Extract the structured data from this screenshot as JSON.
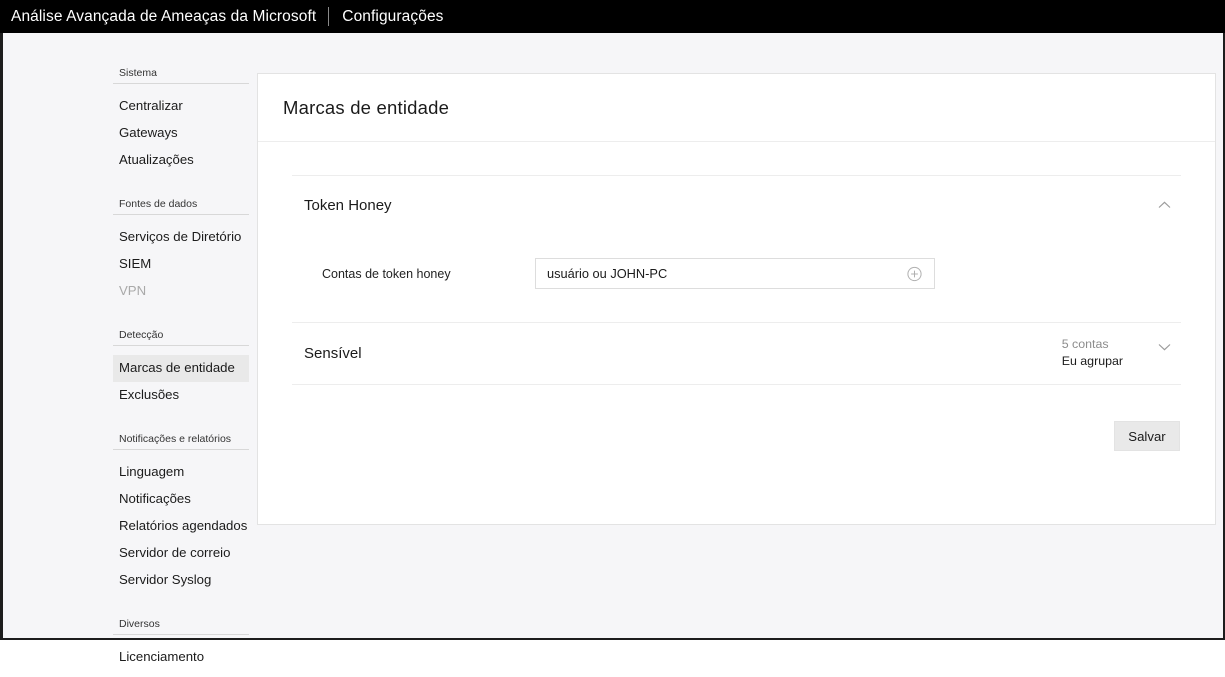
{
  "topbar": {
    "product": "Análise Avançada de Ameaças da Microsoft",
    "section": "Configurações"
  },
  "sidebar": {
    "groups": [
      {
        "title": "Sistema",
        "items": [
          {
            "label": "Centralizar",
            "state": "normal"
          },
          {
            "label": "Gateways",
            "state": "normal"
          },
          {
            "label": "Atualizações",
            "state": "normal"
          }
        ]
      },
      {
        "title": "Fontes de dados",
        "items": [
          {
            "label": "Serviços de Diretório",
            "state": "normal"
          },
          {
            "label": "SIEM",
            "state": "normal"
          },
          {
            "label": "VPN",
            "state": "disabled"
          }
        ]
      },
      {
        "title": "Detecção",
        "items": [
          {
            "label": "Marcas de entidade",
            "state": "selected"
          },
          {
            "label": "Exclusões",
            "state": "normal"
          }
        ]
      },
      {
        "title": "Notificações e relatórios",
        "items": [
          {
            "label": "Linguagem",
            "state": "normal"
          },
          {
            "label": "Notificações",
            "state": "normal"
          },
          {
            "label": "Relatórios agendados",
            "state": "normal"
          },
          {
            "label": "Servidor de correio",
            "state": "normal"
          },
          {
            "label": "Servidor Syslog",
            "state": "normal"
          }
        ]
      },
      {
        "title": "Diversos",
        "items": [
          {
            "label": "Licenciamento",
            "state": "normal"
          }
        ]
      }
    ]
  },
  "main": {
    "title": "Marcas de entidade",
    "token_honey": {
      "title": "Token Honey",
      "collapse_icon": "chevron-up-icon",
      "field_label": "Contas de token honey",
      "field_value": "",
      "field_placeholder": "usuário ou JOHN-PC",
      "add_icon": "plus-circle-icon"
    },
    "sensitive": {
      "title": "Sensível",
      "count": "5 contas",
      "group": "Eu agrupar",
      "expand_icon": "chevron-down-icon"
    },
    "save_label": "Salvar"
  },
  "colors": {
    "topbar_bg": "#000000",
    "page_bg": "#f6f6f8",
    "card_bg": "#ffffff",
    "selected_nav_bg": "#e9e9e9",
    "button_bg": "#e9e9e9",
    "muted_text": "#8d8d8d",
    "disabled_text": "#a9a9a9"
  }
}
